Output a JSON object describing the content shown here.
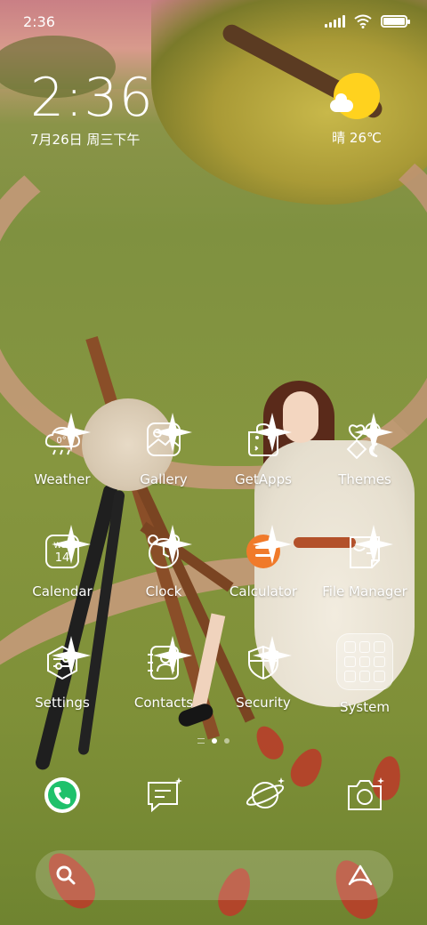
{
  "status_bar": {
    "time": "2:36",
    "battery_level": 1.0
  },
  "clock_widget": {
    "time": "2:36",
    "date": "7月26日 周三下午"
  },
  "weather_widget": {
    "text": "晴 26℃",
    "icon": "sunny-cloud-icon"
  },
  "apps_row1": [
    {
      "label": "Weather",
      "icon": "weather-icon",
      "icon_text": "0°"
    },
    {
      "label": "Gallery",
      "icon": "gallery-icon"
    },
    {
      "label": "GetApps",
      "icon": "getapps-icon"
    },
    {
      "label": "Themes",
      "icon": "themes-icon"
    }
  ],
  "apps_row2": [
    {
      "label": "Calendar",
      "icon": "calendar-icon",
      "icon_day": "Wed",
      "icon_date": "14"
    },
    {
      "label": "Clock",
      "icon": "clock-icon"
    },
    {
      "label": "Calculator",
      "icon": "calculator-icon"
    },
    {
      "label": "File Manager",
      "icon": "file-manager-icon"
    }
  ],
  "apps_row3": [
    {
      "label": "Settings",
      "icon": "settings-icon"
    },
    {
      "label": "Contacts",
      "icon": "contacts-icon"
    },
    {
      "label": "Security",
      "icon": "security-icon"
    },
    {
      "label": "System",
      "icon": "folder-icon"
    }
  ],
  "dock": [
    {
      "icon": "phone-icon"
    },
    {
      "icon": "messages-icon"
    },
    {
      "icon": "browser-icon"
    },
    {
      "icon": "camera-icon"
    }
  ],
  "search_bar": {
    "left_icon": "search-icon",
    "right_icon": "assistant-icon"
  },
  "colors": {
    "accent_orange": "#f07a2a",
    "phone_green": "#1fc16b",
    "sun_yellow": "#ffd21e"
  }
}
